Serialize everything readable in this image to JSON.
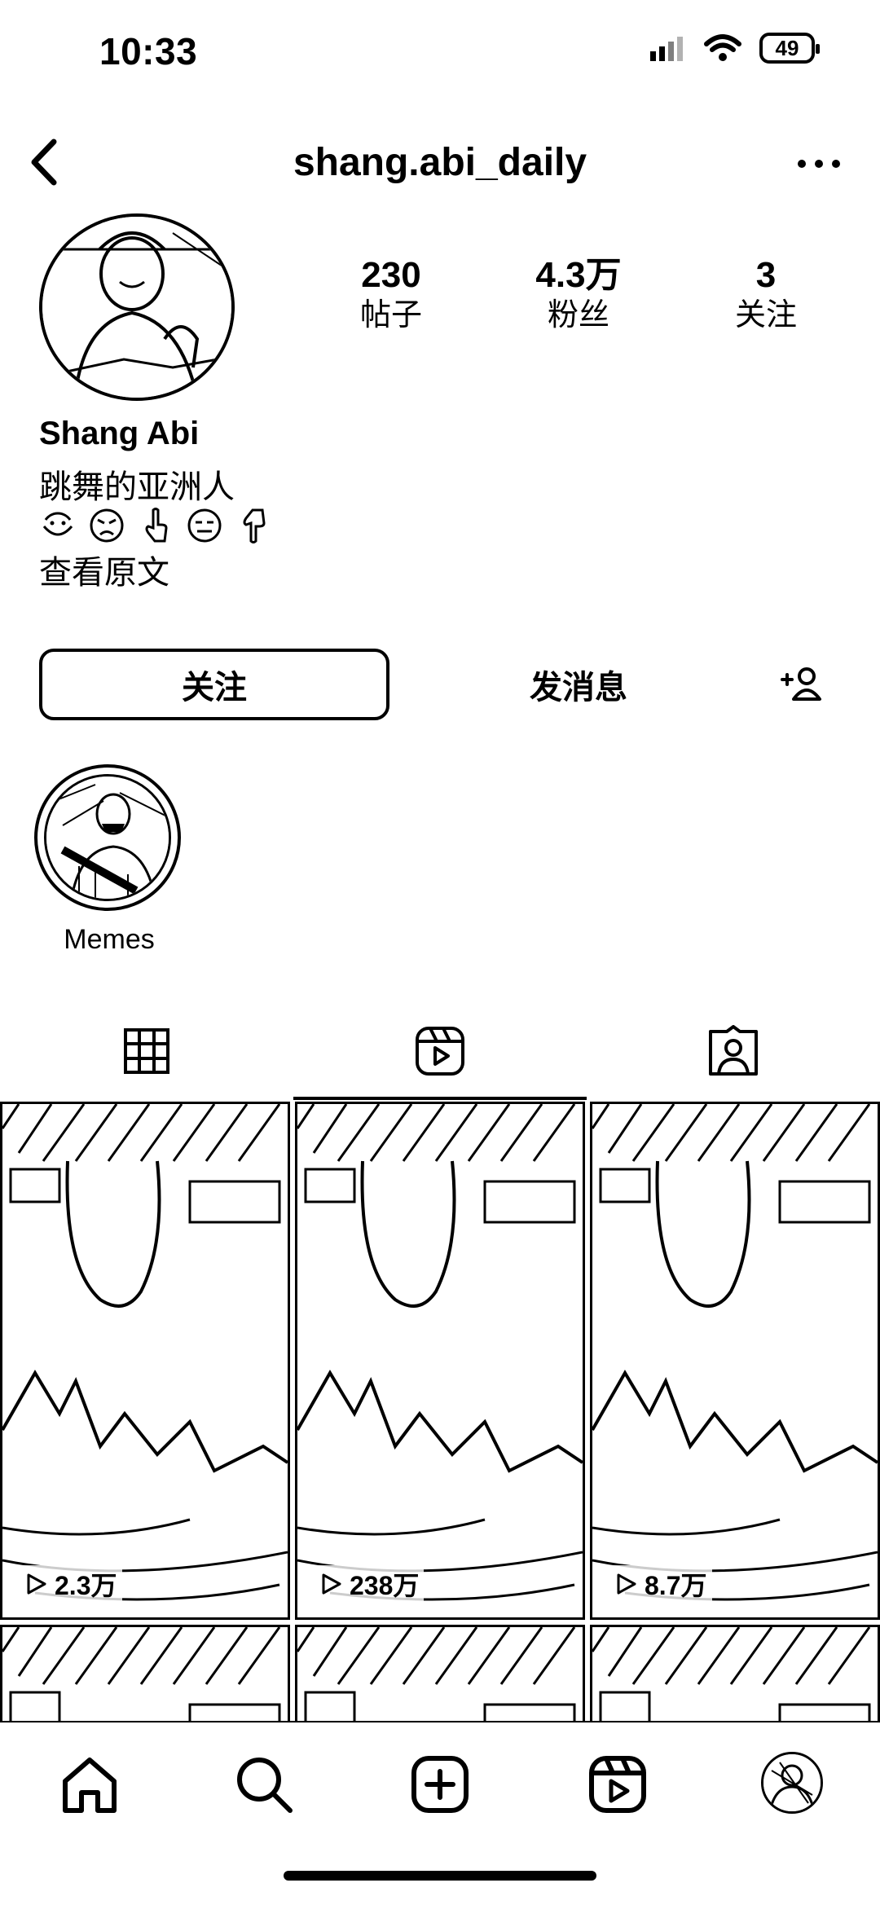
{
  "status_bar": {
    "time": "10:33",
    "battery": "49"
  },
  "header": {
    "username": "shang.abi_daily"
  },
  "profile": {
    "stats": [
      {
        "value": "230",
        "label": "帖子"
      },
      {
        "value": "4.3万",
        "label": "粉丝"
      },
      {
        "value": "3",
        "label": "关注"
      }
    ],
    "display_name": "Shang Abi",
    "bio": "跳舞的亚洲人",
    "emojis": [
      "smile-icon",
      "angry-face-icon",
      "pointing-up-icon",
      "expressionless-icon",
      "pointing-down-icon"
    ],
    "see_translation": "查看原文"
  },
  "actions": {
    "follow": "关注",
    "message": "发消息"
  },
  "highlights": [
    {
      "label": "Memes"
    }
  ],
  "tabs": [
    "grid-icon",
    "reels-icon",
    "tagged-icon"
  ],
  "reels": [
    {
      "views": "2.3万"
    },
    {
      "views": "238万"
    },
    {
      "views": "8.7万"
    }
  ],
  "nav": [
    "home-icon",
    "search-icon",
    "create-icon",
    "reels-icon",
    "profile-avatar"
  ]
}
